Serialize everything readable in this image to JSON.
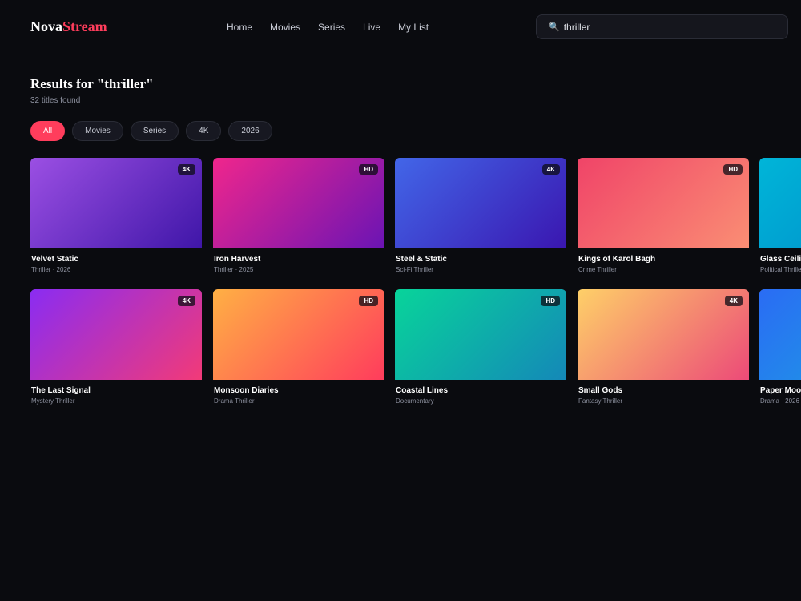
{
  "header": {
    "logo_main": "Nova",
    "logo_accent": "Stream",
    "nav": [
      "Home",
      "Movies",
      "Series",
      "Live",
      "My List"
    ],
    "search_value": "thriller",
    "search_icon": "magnifier-icon"
  },
  "results": {
    "title": "Results for \"thriller\"",
    "count": "32 titles found"
  },
  "filters": [
    "All",
    "Movies",
    "Series",
    "4K",
    "2026"
  ],
  "active_filter": "All",
  "colors": {
    "accent": "#ff3d5c",
    "background": "#0a0b0f"
  },
  "cards": [
    {
      "title": "Velvet Static",
      "meta": "Thriller · 2026",
      "badge": "4K",
      "gradient": [
        "#9b4fe3",
        "#3f16a8"
      ]
    },
    {
      "title": "Iron Harvest",
      "meta": "Thriller · 2025",
      "badge": "HD",
      "gradient": [
        "#f0268c",
        "#6a14b4"
      ]
    },
    {
      "title": "Steel & Static",
      "meta": "Sci-Fi Thriller",
      "badge": "4K",
      "gradient": [
        "#4266e8",
        "#3a16b0"
      ]
    },
    {
      "title": "Kings of Karol Bagh",
      "meta": "Crime Thriller",
      "badge": "HD",
      "gradient": [
        "#f04468",
        "#fa8e74"
      ]
    },
    {
      "title": "Glass Ceiling",
      "meta": "Political Thriller",
      "badge": "",
      "gradient": [
        "#00b5d8",
        "#0088c8"
      ]
    },
    {
      "title": "The Last Signal",
      "meta": "Mystery Thriller",
      "badge": "4K",
      "gradient": [
        "#8a2cf2",
        "#f23a78"
      ]
    },
    {
      "title": "Monsoon Diaries",
      "meta": "Drama Thriller",
      "badge": "HD",
      "gradient": [
        "#ffb044",
        "#ff3c5c"
      ]
    },
    {
      "title": "Coastal Lines",
      "meta": "Documentary",
      "badge": "HD",
      "gradient": [
        "#08d49a",
        "#1488b8"
      ]
    },
    {
      "title": "Small Gods",
      "meta": "Fantasy Thriller",
      "badge": "4K",
      "gradient": [
        "#fed068",
        "#ec4a78"
      ]
    },
    {
      "title": "Paper Moon",
      "meta": "Drama · 2026",
      "badge": "",
      "gradient": [
        "#2a6cf4",
        "#1aa6e0"
      ]
    }
  ]
}
